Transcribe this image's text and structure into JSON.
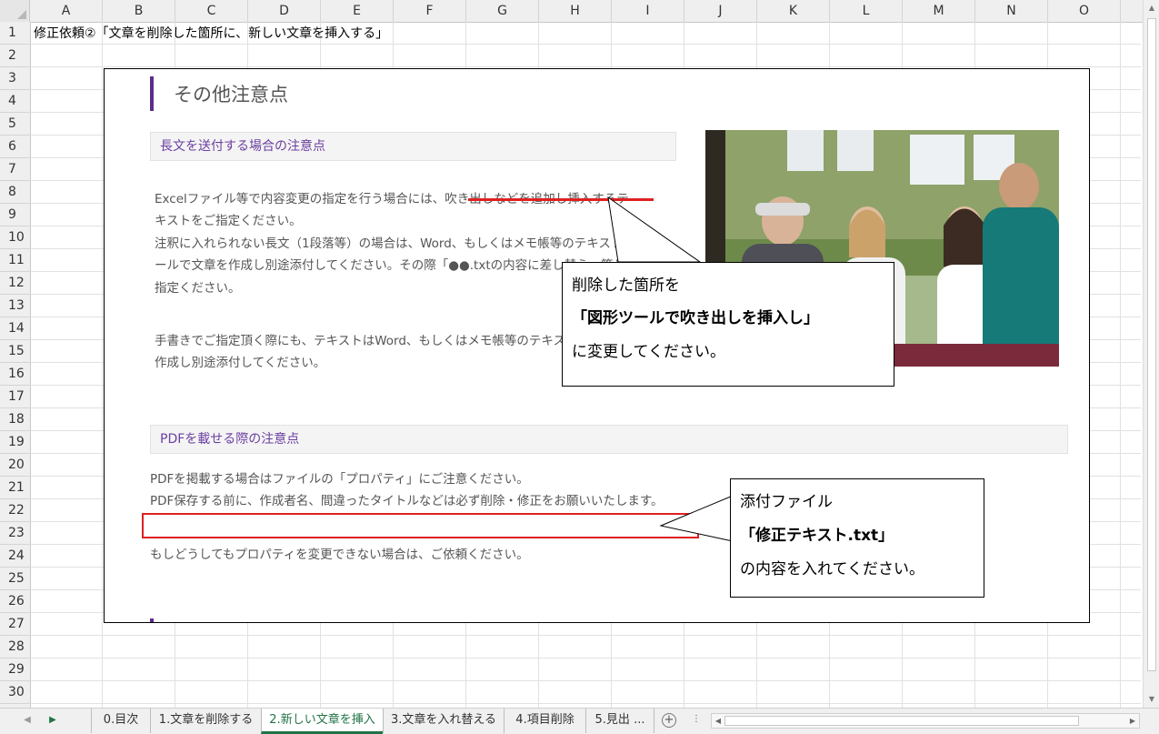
{
  "columns": [
    "A",
    "B",
    "C",
    "D",
    "E",
    "F",
    "G",
    "H",
    "I",
    "J",
    "K",
    "L",
    "M",
    "N",
    "O"
  ],
  "rows": [
    "1",
    "2",
    "3",
    "4",
    "5",
    "6",
    "7",
    "8",
    "9",
    "10",
    "11",
    "12",
    "13",
    "14",
    "15",
    "16",
    "17",
    "18",
    "19",
    "20",
    "21",
    "22",
    "23",
    "24",
    "25",
    "26",
    "27",
    "28",
    "29",
    "30"
  ],
  "cell_a1": "修正依頼②「文章を削除した箇所に、新しい文章を挿入する」",
  "embedded": {
    "title": "その他注意点",
    "section1": "長文を送付する場合の注意点",
    "para1": [
      "Excelファイル等で内容変更の指定を行う場合には、吹き出しなどを追加し挿入するテ",
      "キストをご指定ください。",
      "注釈に入れられない長文（1段落等）の場合は、Word、もしくはメモ帳等のテキストツ",
      "ールで文章を作成し別途添付してください。その際「●●.txtの内容に差し替え」等とご",
      "指定ください。"
    ],
    "para2": [
      "手書きでご指定頂く際にも、テキストはWord、もしくはメモ帳等のテキストツールで",
      "作成し別途添付してください。"
    ],
    "section2": "PDFを載せる際の注意点",
    "para3": [
      "PDFを掲載する場合はファイルの「プロパティ」にご注意ください。",
      "PDF保存する前に、作成者名、間違ったタイトルなどは必ず削除・修正をお願いいたします。"
    ],
    "para4": "もしどうしてもプロパティを変更できない場合は、ご依頼ください。"
  },
  "callout1": {
    "line1": "削除した箇所を",
    "line2": "「図形ツールで吹き出しを挿入し」",
    "line3": "に変更してください。"
  },
  "callout2": {
    "line1": "添付ファイル",
    "line2": "「修正テキスト.txt」",
    "line3": "の内容を入れてください。"
  },
  "tabs": [
    {
      "label": "0.目次"
    },
    {
      "label": "1.文章を削除する"
    },
    {
      "label": "2.新しい文章を挿入"
    },
    {
      "label": "3.文章を入れ替える"
    },
    {
      "label": "4.項目削除"
    },
    {
      "label": "5.見出 ..."
    }
  ],
  "active_tab": "2.新しい文章を挿入",
  "colors": {
    "accent": "#217346",
    "purple": "#5b2d8a",
    "red": "#e02020"
  }
}
